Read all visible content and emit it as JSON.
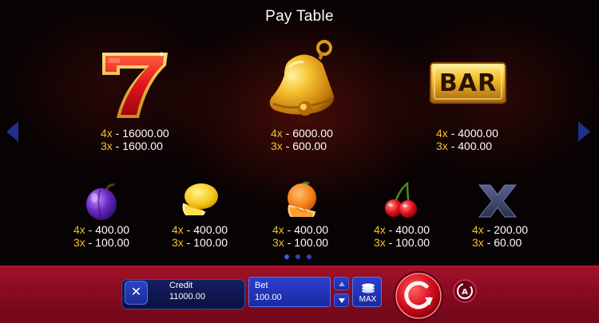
{
  "title": "Pay Table",
  "symbols_top": [
    {
      "icon": "seven-icon",
      "lines": [
        {
          "mult": "4x",
          "sep": " - ",
          "value": "16000.00"
        },
        {
          "mult": "3x",
          "sep": " - ",
          "value": "1600.00"
        }
      ]
    },
    {
      "icon": "bell-icon",
      "lines": [
        {
          "mult": "4x",
          "sep": " - ",
          "value": "6000.00"
        },
        {
          "mult": "3x",
          "sep": " - ",
          "value": "600.00"
        }
      ]
    },
    {
      "icon": "bar-icon",
      "text": "BAR",
      "lines": [
        {
          "mult": "4x",
          "sep": " - ",
          "value": "4000.00"
        },
        {
          "mult": "3x",
          "sep": " - ",
          "value": "400.00"
        }
      ]
    }
  ],
  "symbols_bottom": [
    {
      "icon": "plum-icon",
      "lines": [
        {
          "mult": "4x",
          "sep": " - ",
          "value": "400.00"
        },
        {
          "mult": "3x",
          "sep": " - ",
          "value": "100.00"
        }
      ]
    },
    {
      "icon": "lemon-icon",
      "lines": [
        {
          "mult": "4x",
          "sep": " - ",
          "value": "400.00"
        },
        {
          "mult": "3x",
          "sep": " - ",
          "value": "100.00"
        }
      ]
    },
    {
      "icon": "orange-icon",
      "lines": [
        {
          "mult": "4x",
          "sep": " - ",
          "value": "400.00"
        },
        {
          "mult": "3x",
          "sep": " - ",
          "value": "100.00"
        }
      ]
    },
    {
      "icon": "cherry-icon",
      "lines": [
        {
          "mult": "4x",
          "sep": " - ",
          "value": "400.00"
        },
        {
          "mult": "3x",
          "sep": " - ",
          "value": "100.00"
        }
      ]
    },
    {
      "icon": "x-icon",
      "lines": [
        {
          "mult": "4x",
          "sep": " - ",
          "value": "200.00"
        },
        {
          "mult": "3x",
          "sep": " - ",
          "value": "60.00"
        }
      ]
    }
  ],
  "pagination": {
    "pages": 3,
    "current": 1
  },
  "controls": {
    "close_label": "✕",
    "credit_label": "Credit",
    "credit_value": "11000.00",
    "bet_label": "Bet",
    "bet_value": "100.00",
    "max_label": "MAX"
  },
  "colors": {
    "multiplier": "#f2c22b",
    "value": "#ffffff",
    "bar_red": "#8a0c22",
    "button_blue": "#2236b8"
  }
}
